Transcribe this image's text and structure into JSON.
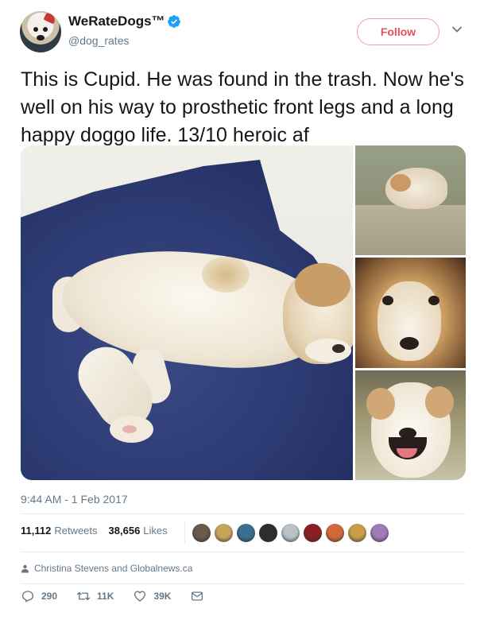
{
  "author": {
    "name": "WeRateDogs™",
    "handle": "@dog_rates"
  },
  "follow_label": "Follow",
  "tweet_text": "This is Cupid. He was found in the trash. Now he's well on his way to prosthetic front legs and a long happy doggo life. 13/10 heroic af",
  "timestamp": "9:44 AM - 1 Feb 2017",
  "stats": {
    "retweets_count": "11,112",
    "retweets_label": "Retweets",
    "likes_count": "38,656",
    "likes_label": "Likes"
  },
  "liker_avatar_colors": [
    "#6a5a4a",
    "#c7a45c",
    "#3b6f8f",
    "#2d2d2d",
    "#b9c2c9",
    "#8a1f24",
    "#d16a3b",
    "#c99d48",
    "#9f7bb8"
  ],
  "media_context": "Christina Stevens and Globalnews.ca",
  "actions": {
    "reply_count": "290",
    "retweet_count": "11K",
    "like_count": "39K"
  },
  "colors": {
    "accent": "#1da1f2",
    "follow_outline": "#e8505f",
    "muted_text": "#657786"
  }
}
